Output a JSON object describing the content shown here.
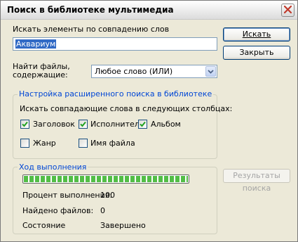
{
  "window": {
    "title": "Поиск в библиотеке мультимедиа"
  },
  "search": {
    "label": "Искать элементы по совпадению слов",
    "value": "Аквариум"
  },
  "find_files": {
    "label_line1": "Найти файлы,",
    "label_line2": "содержащие:",
    "selected_option": "Любое слово (ИЛИ)"
  },
  "buttons": {
    "search": "Искать",
    "close": "Закрыть",
    "results": "Результаты поиска"
  },
  "advanced": {
    "legend": "Настройка расширенного поиска в библиотеке",
    "instruction": "Искать совпадающие слова в следующих столбцах:",
    "columns": [
      {
        "label": "Заголовок",
        "checked": true
      },
      {
        "label": "Исполнитель",
        "checked": true
      },
      {
        "label": "Альбом",
        "checked": true
      },
      {
        "label": "Жанр",
        "checked": false
      },
      {
        "label": "Имя файла",
        "checked": false
      }
    ]
  },
  "progress": {
    "legend": "Ход выполнения",
    "percent_label": "Процент выполнения:",
    "percent_value": "100",
    "percent_fraction": 1.0,
    "found_label": "Найдено файлов:",
    "found_value": "0",
    "status_label": "Состояние",
    "status_value": "Завершено"
  },
  "colors": {
    "group_legend": "#0046d5",
    "progress_fill": "#52bd46",
    "close_x": "#c0392b"
  }
}
